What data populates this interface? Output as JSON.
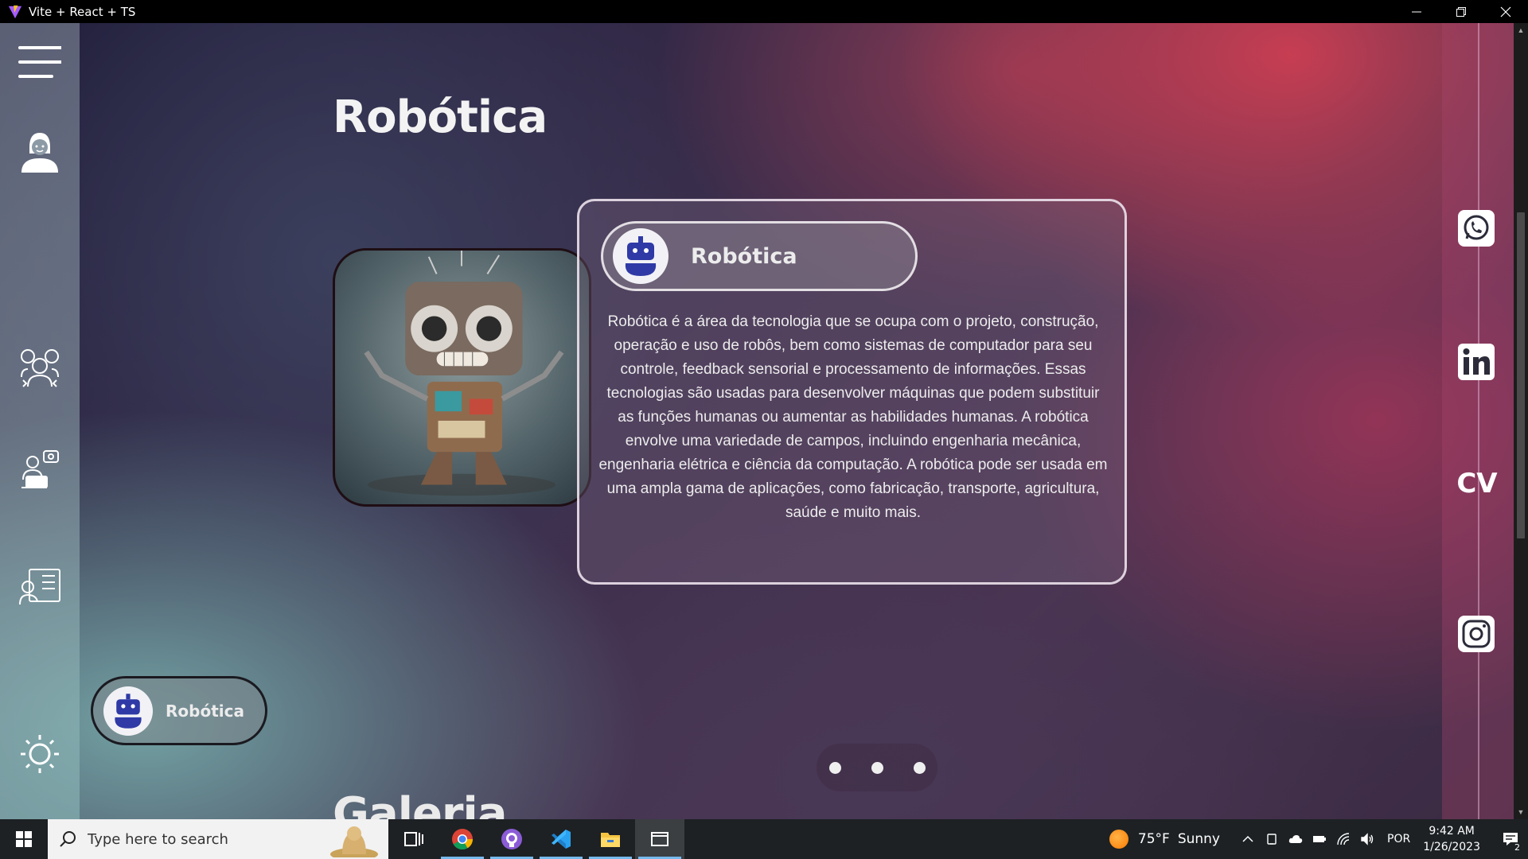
{
  "window": {
    "title": "Vite + React + TS",
    "controls": [
      "minimize",
      "restore",
      "close"
    ]
  },
  "sidebar": {
    "items": [
      {
        "icon": "menu-icon"
      },
      {
        "icon": "user-avatar-icon"
      },
      {
        "icon": "team-icon"
      },
      {
        "icon": "developer-chat-icon"
      },
      {
        "icon": "resume-icon"
      },
      {
        "icon": "theme-sun-icon"
      }
    ]
  },
  "main": {
    "title": "Robótica",
    "card": {
      "header_label": "Robótica",
      "description": "Robótica é a área da tecnologia que se ocupa com o projeto, construção, operação e uso de robôs, bem como sistemas de computador para seu controle, feedback sensorial e processamento de informações. Essas tecnologias são usadas para desenvolver máquinas que podem substituir as funções humanas ou aumentar as habilidades humanas. A robótica envolve uma variedade de campos, incluindo engenharia mecânica, engenharia elétrica e ciência da computação. A robótica pode ser usada em uma ampla gama de aplicações, como fabricação, transporte, agricultura, saúde e muito mais."
    },
    "chip_label": "Robótica",
    "pager": {
      "count": 3
    },
    "next_section_title": "Galeria"
  },
  "social": {
    "items": [
      {
        "name": "whatsapp-icon"
      },
      {
        "name": "linkedin-icon"
      },
      {
        "name": "cv",
        "label": "CV"
      },
      {
        "name": "instagram-icon"
      }
    ]
  },
  "taskbar": {
    "search_placeholder": "Type here to search",
    "weather": {
      "temp": "75°F",
      "condition": "Sunny"
    },
    "language": "POR",
    "time": "9:42 AM",
    "date": "1/26/2023",
    "notification_count": "2"
  },
  "colors": {
    "accent_blue": "#2f3aa6",
    "taskbar": "#1d2124"
  }
}
